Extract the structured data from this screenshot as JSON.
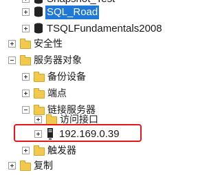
{
  "tree": {
    "db_snapshot_partial": "Snapshot_Test",
    "db_sql_road": "SQL_Road",
    "db_tsql": "TSQLFundamentals2008",
    "security": "安全性",
    "server_objects": "服务器对象",
    "backup_devices": "备份设备",
    "endpoints": "端点",
    "linked_servers": "链接服务器",
    "providers": "访问接口",
    "linked_server_ip": "192.169.0.39",
    "triggers": "触发器",
    "replication": "复制"
  },
  "colors": {
    "selection": "#1e78d7",
    "annotation_box": "#e8161c",
    "folder": "#f2c94c"
  }
}
